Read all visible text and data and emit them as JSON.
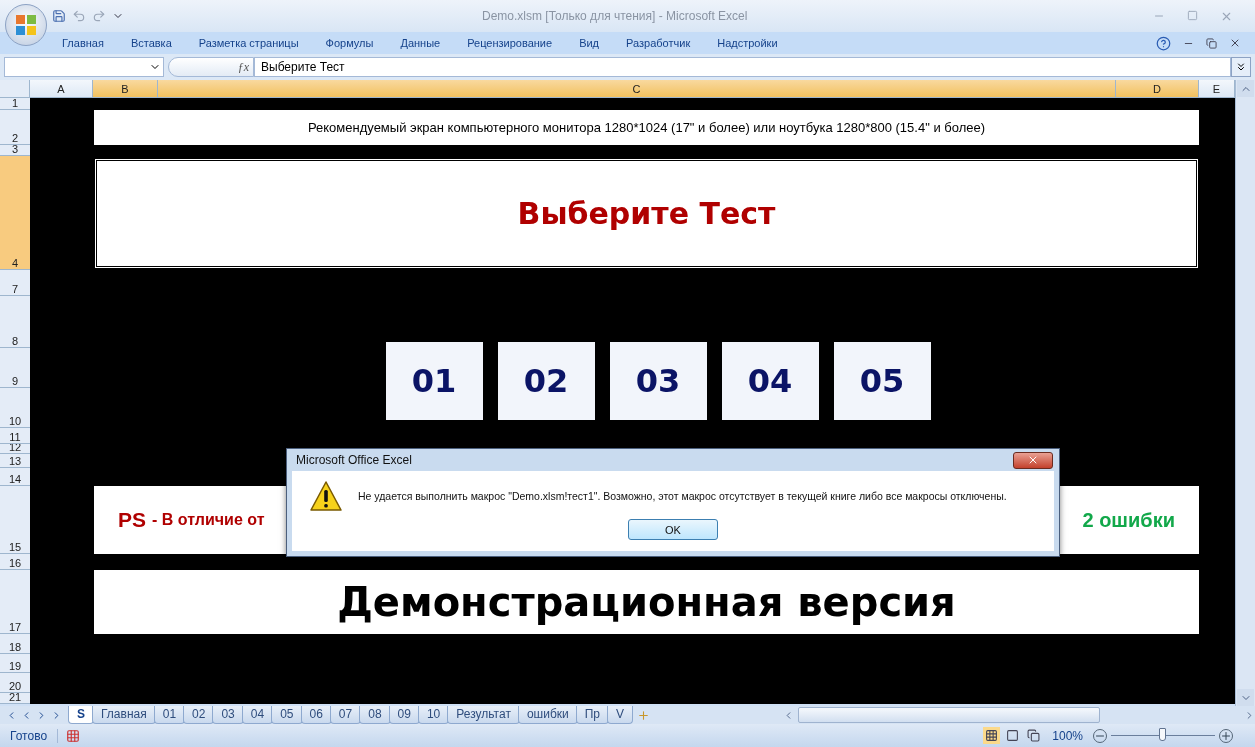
{
  "window": {
    "title": "Demo.xlsm [Только для чтения] - Microsoft Excel"
  },
  "ribbon_tabs": [
    "Главная",
    "Вставка",
    "Разметка страницы",
    "Формулы",
    "Данные",
    "Рецензирование",
    "Вид",
    "Разработчик",
    "Надстройки"
  ],
  "formula_bar": {
    "fx": "ƒx",
    "formula": "Выберите Тест"
  },
  "columns": [
    {
      "label": "A",
      "selected": false
    },
    {
      "label": "B",
      "selected": true
    },
    {
      "label": "C",
      "selected": true
    },
    {
      "label": "D",
      "selected": true
    },
    {
      "label": "E",
      "selected": false
    }
  ],
  "rows": [
    {
      "label": "1",
      "selected": false
    },
    {
      "label": "2",
      "selected": false
    },
    {
      "label": "3",
      "selected": false
    },
    {
      "label": "4",
      "selected": true
    },
    {
      "label": "7",
      "selected": false
    },
    {
      "label": "8",
      "selected": false
    },
    {
      "label": "9",
      "selected": false
    },
    {
      "label": "10",
      "selected": false
    },
    {
      "label": "11",
      "selected": false
    },
    {
      "label": "12",
      "selected": false
    },
    {
      "label": "13",
      "selected": false
    },
    {
      "label": "14",
      "selected": false
    },
    {
      "label": "15",
      "selected": false
    },
    {
      "label": "16",
      "selected": false
    },
    {
      "label": "17",
      "selected": false
    },
    {
      "label": "18",
      "selected": false
    },
    {
      "label": "19",
      "selected": false
    },
    {
      "label": "20",
      "selected": false
    },
    {
      "label": "21",
      "selected": false
    }
  ],
  "sheet": {
    "note": "Рекомендуемый экран компьютерного монитора 1280*1024 (17\" и более) или ноутбука 1280*800 (15.4\" и более)",
    "title": "Выберите Тест",
    "test_buttons": [
      "01",
      "02",
      "03",
      "04",
      "05"
    ],
    "ps": {
      "lead": "PS",
      "text": "- В отличие от",
      "tail": "2 ошибки"
    },
    "banner": "Демонстрационная версия"
  },
  "dialog": {
    "title": "Microsoft Office Excel",
    "message": "Не удается выполнить макрос \"Demo.xlsm!тест1\". Возможно, этот макрос отсутствует в текущей книге либо все макросы отключены.",
    "button": "OK"
  },
  "sheet_tabs": [
    {
      "label": "S",
      "selected": true
    },
    {
      "label": "Главная",
      "selected": false
    },
    {
      "label": "01",
      "selected": false
    },
    {
      "label": "02",
      "selected": false
    },
    {
      "label": "03",
      "selected": false
    },
    {
      "label": "04",
      "selected": false
    },
    {
      "label": "05",
      "selected": false
    },
    {
      "label": "06",
      "selected": false
    },
    {
      "label": "07",
      "selected": false
    },
    {
      "label": "08",
      "selected": false
    },
    {
      "label": "09",
      "selected": false
    },
    {
      "label": "10",
      "selected": false
    },
    {
      "label": "Результат",
      "selected": false
    },
    {
      "label": "ошибки",
      "selected": false
    },
    {
      "label": "Пр",
      "selected": false
    },
    {
      "label": "V",
      "selected": false
    }
  ],
  "status_bar": {
    "status": "Готово",
    "zoom": "100%",
    "zoom_slider": {
      "level": 0.5
    }
  }
}
